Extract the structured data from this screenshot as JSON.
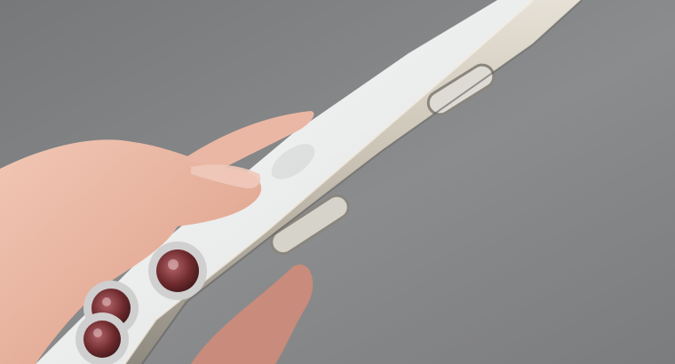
{
  "colors": {
    "background": "#8a8b8d",
    "phone_back": "#e9eaeb",
    "phone_frame": "#b9b3a6",
    "button_fill": "#d9d7d0",
    "skin": "#e8b8a4",
    "lens_rim": "#c9c9c9",
    "lens_glass": "#6e2a2d"
  },
  "icons": {
    "logo": "apple-logo-icon",
    "volume_button": "volume-button-icon",
    "side_button": "side-button-icon",
    "camera": "camera-lens-icon"
  }
}
